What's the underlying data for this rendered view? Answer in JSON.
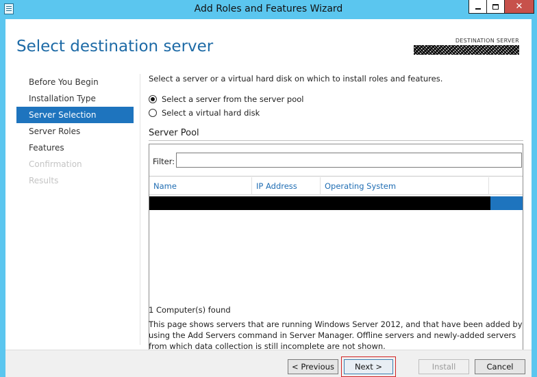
{
  "window": {
    "title": "Add Roles and Features Wizard"
  },
  "header": {
    "page_title": "Select destination server",
    "destination_label": "DESTINATION SERVER"
  },
  "nav": {
    "items": [
      {
        "label": "Before You Begin",
        "state": "normal"
      },
      {
        "label": "Installation Type",
        "state": "normal"
      },
      {
        "label": "Server Selection",
        "state": "active"
      },
      {
        "label": "Server Roles",
        "state": "normal"
      },
      {
        "label": "Features",
        "state": "normal"
      },
      {
        "label": "Confirmation",
        "state": "disabled"
      },
      {
        "label": "Results",
        "state": "disabled"
      }
    ]
  },
  "main": {
    "intro": "Select a server or a virtual hard disk on which to install roles and features.",
    "options": [
      {
        "label": "Select a server from the server pool",
        "checked": true
      },
      {
        "label": "Select a virtual hard disk",
        "checked": false
      }
    ],
    "pool_title": "Server Pool",
    "filter_label": "Filter:",
    "filter_value": "",
    "columns": [
      "Name",
      "IP Address",
      "Operating System"
    ],
    "found_text": "1 Computer(s) found",
    "description": "This page shows servers that are running Windows Server 2012, and that have been added by using the Add Servers command in Server Manager. Offline servers and newly-added servers from which data collection is still incomplete are not shown."
  },
  "footer": {
    "previous_label": "< Previous",
    "next_label": "Next >",
    "install_label": "Install",
    "cancel_label": "Cancel"
  },
  "colors": {
    "titlebar": "#5bc6ef",
    "accent": "#1e74be",
    "header_title": "#1d6aa6",
    "close_button": "#c7514b"
  }
}
